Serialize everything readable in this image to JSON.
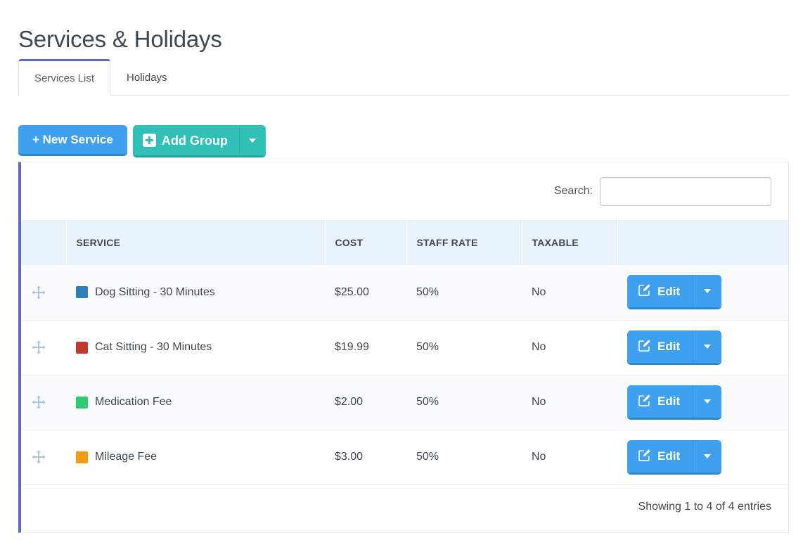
{
  "page": {
    "title": "Services & Holidays"
  },
  "tabs": [
    {
      "label": "Services List",
      "active": true
    },
    {
      "label": "Holidays",
      "active": false
    }
  ],
  "toolbar": {
    "new_service_label": "+ New Service",
    "add_group_label": "Add Group",
    "add_group_icon": "plus-square-icon",
    "add_group_caret_icon": "chevron-down-icon",
    "new_service_color": "#3ea0ee",
    "add_group_color": "#31c0b8"
  },
  "search": {
    "label": "Search:",
    "value": "",
    "placeholder": ""
  },
  "table": {
    "columns": [
      "",
      "SERVICE",
      "COST",
      "STAFF RATE",
      "TAXABLE",
      ""
    ],
    "rows": [
      {
        "handle_icon": "move-arrows-icon",
        "color": "#2e7eb8",
        "service": "Dog Sitting - 30 Minutes",
        "cost": "$25.00",
        "staff_rate": "50%",
        "taxable": "No",
        "edit_label": "Edit",
        "edit_icon": "pencil-square-icon"
      },
      {
        "handle_icon": "move-arrows-icon",
        "color": "#c0392b",
        "service": "Cat Sitting - 30 Minutes",
        "cost": "$19.99",
        "staff_rate": "50%",
        "taxable": "No",
        "edit_label": "Edit",
        "edit_icon": "pencil-square-icon"
      },
      {
        "handle_icon": "move-arrows-icon",
        "color": "#2ecc71",
        "service": "Medication Fee",
        "cost": "$2.00",
        "staff_rate": "50%",
        "taxable": "No",
        "edit_label": "Edit",
        "edit_icon": "pencil-square-icon"
      },
      {
        "handle_icon": "move-arrows-icon",
        "color": "#f39c12",
        "service": "Mileage Fee",
        "cost": "$3.00",
        "staff_rate": "50%",
        "taxable": "No",
        "edit_label": "Edit",
        "edit_icon": "pencil-square-icon"
      }
    ]
  },
  "footer": {
    "info": "Showing 1 to 4 of 4 entries"
  },
  "theme": {
    "accent_purple": "#5c6ac4",
    "header_bg": "#e8f3fd",
    "blue": "#3ea0ee",
    "teal": "#31c0b8"
  }
}
